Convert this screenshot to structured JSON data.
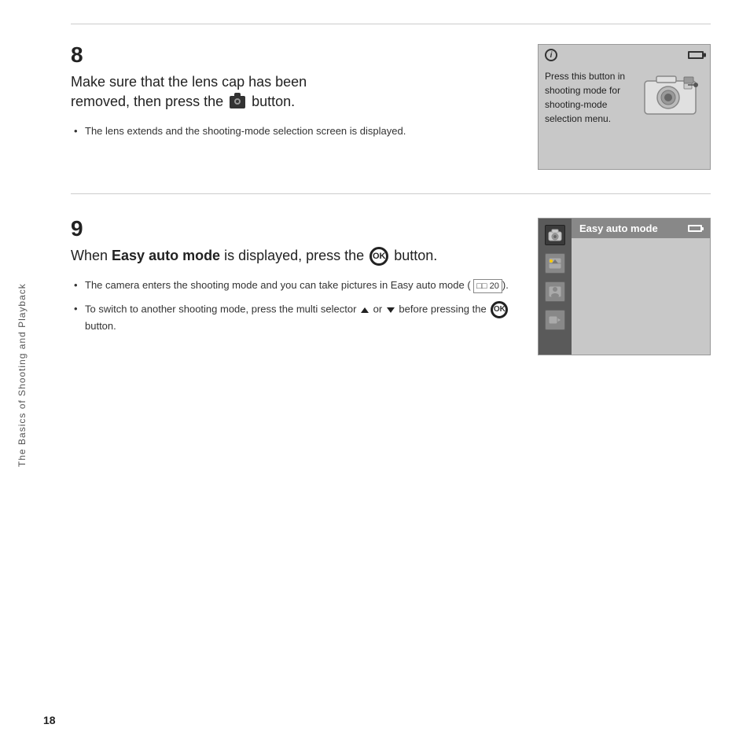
{
  "page": {
    "number": "18",
    "sidebar_label": "The Basics of Shooting and Playback"
  },
  "step8": {
    "number": "8",
    "heading_part1": "Make sure that the lens cap has been\nremoved, then press the ",
    "heading_part2": " button.",
    "bullet1": "The lens extends and the shooting-mode selection screen is displayed.",
    "panel": {
      "info_symbol": "i",
      "text_line1": "Press this button in",
      "text_line2": "shooting mode for",
      "text_line3": "shooting-mode",
      "text_line4": "selection menu."
    }
  },
  "step9": {
    "number": "9",
    "heading_part1": "When ",
    "heading_bold": "Easy auto mode",
    "heading_part2": " is displayed, press the ",
    "heading_part3": " button.",
    "bullet1_part1": "The camera enters the shooting mode and you can take pictures in Easy auto mode (",
    "bullet1_ref": "□□ 20",
    "bullet1_part2": ").",
    "bullet2_part1": "To switch to another shooting mode, press the multi selector ",
    "bullet2_part2": " or ",
    "bullet2_part3": " before pressing the ",
    "bullet2_part4": " button.",
    "panel": {
      "mode_label": "Easy auto mode"
    }
  }
}
